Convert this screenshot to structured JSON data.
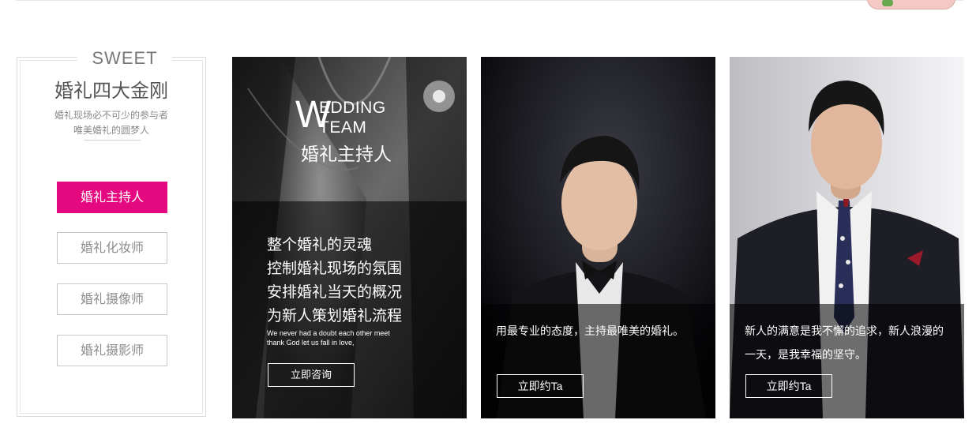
{
  "menu": {
    "sweet": "SWEET",
    "title": "婚礼四大金刚",
    "subtitle_1": "婚礼现场必不可少的参与者",
    "subtitle_2": "唯美婚礼的圆梦人",
    "items": [
      {
        "label": "婚礼主持人",
        "active": true
      },
      {
        "label": "婚礼化妆师",
        "active": false
      },
      {
        "label": "婚礼摄像师",
        "active": false
      },
      {
        "label": "婚礼摄影师",
        "active": false
      }
    ]
  },
  "cards": [
    {
      "heading_w": "W",
      "heading_line1": "EDDING",
      "heading_line2": "TEAM",
      "heading_cn": "婚礼主持人",
      "lines": [
        "整个婚礼的灵魂",
        "控制婚礼现场的氛围",
        "安排婚礼当天的概况",
        "为新人策划婚礼流程"
      ],
      "english_1": "We never had a doubt each other meet",
      "english_2": "thank God let us fall in love,",
      "button": "立即咨询"
    },
    {
      "description": "用最专业的态度，主持最唯美的婚礼。",
      "button": "立即约Ta"
    },
    {
      "description": "新人的满意是我不懈的追求，新人浪漫的一天，是我幸福的坚守。",
      "button": "立即约Ta"
    }
  ],
  "colors": {
    "accent": "#e5097f"
  }
}
